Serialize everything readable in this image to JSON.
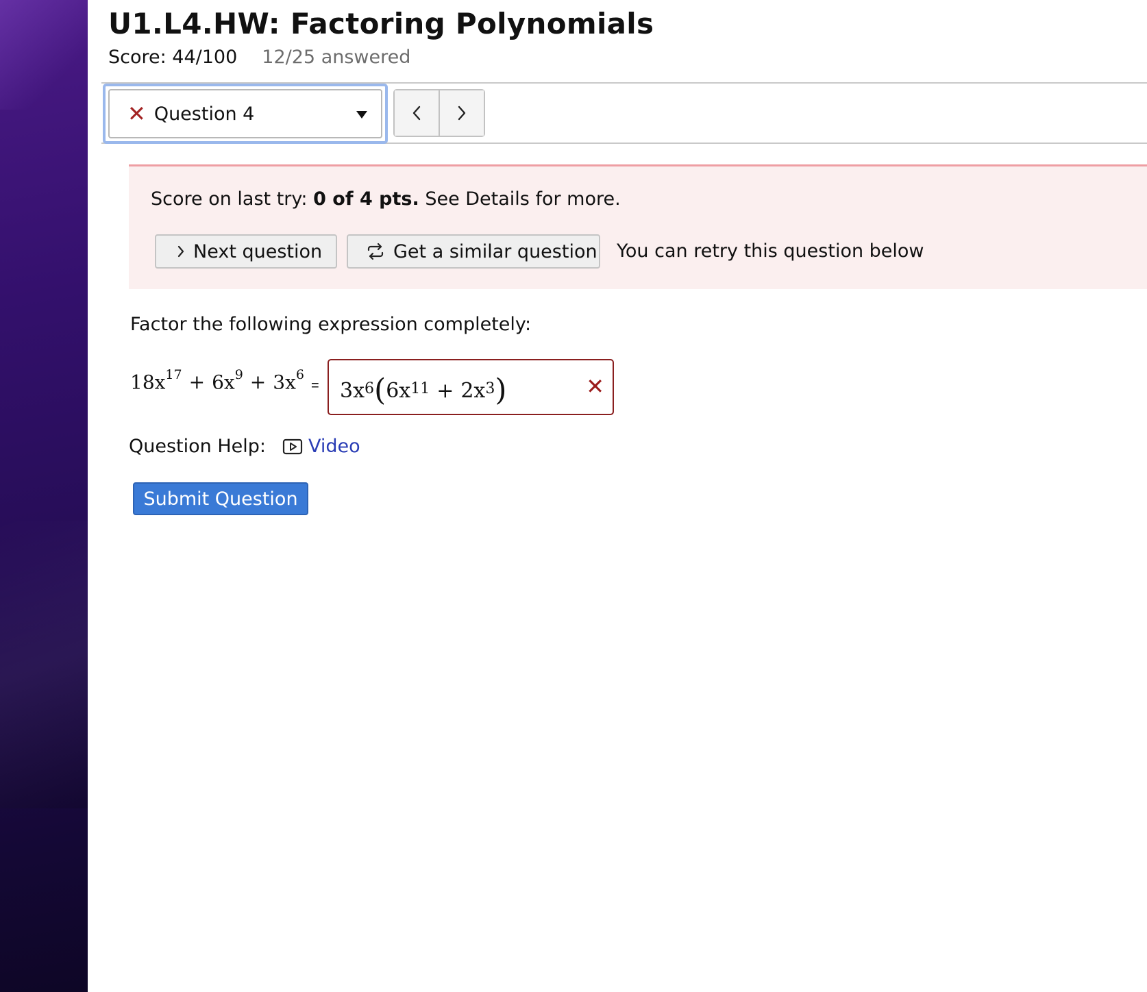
{
  "assignment": {
    "title": "U1.L4.HW: Factoring Polynomials",
    "score": "Score: 44/100",
    "answered": "12/25 answered"
  },
  "question_nav": {
    "current_label": "Question 4",
    "status_icon": "x-mark-icon",
    "prev_label": "‹",
    "next_label": "›"
  },
  "alert": {
    "prefix": "Score on last try: ",
    "score": "0 of 4 pts.",
    "suffix": " See Details for more.",
    "next_question_label": "Next question",
    "similar_question_label": "Get a similar question",
    "retry_text": "You can retry this question below",
    "background_color": "#fbefef",
    "border_color": "#ee9ea3"
  },
  "question": {
    "prompt": "Factor the following expression completely:",
    "expression": {
      "t1_coef": "18x",
      "t1_exp": "17",
      "t2_coef": "6x",
      "t2_exp": "9",
      "t3_coef": "3x",
      "t3_exp": "6",
      "plus": "+",
      "equals": "="
    },
    "answer": {
      "coef": "3x",
      "exp": "6",
      "open": "(",
      "close": ")",
      "a_coef": "6x",
      "a_exp": "11",
      "b_coef": "2x",
      "b_exp": "3",
      "plus": "+",
      "status_icon": "wrong-x-icon",
      "status_color": "#9b1c1c"
    }
  },
  "help": {
    "label": "Question Help:",
    "video_label": "Video",
    "link_color": "#2a3db5"
  },
  "submit": {
    "label": "Submit Question",
    "color": "#3a7ad6"
  }
}
